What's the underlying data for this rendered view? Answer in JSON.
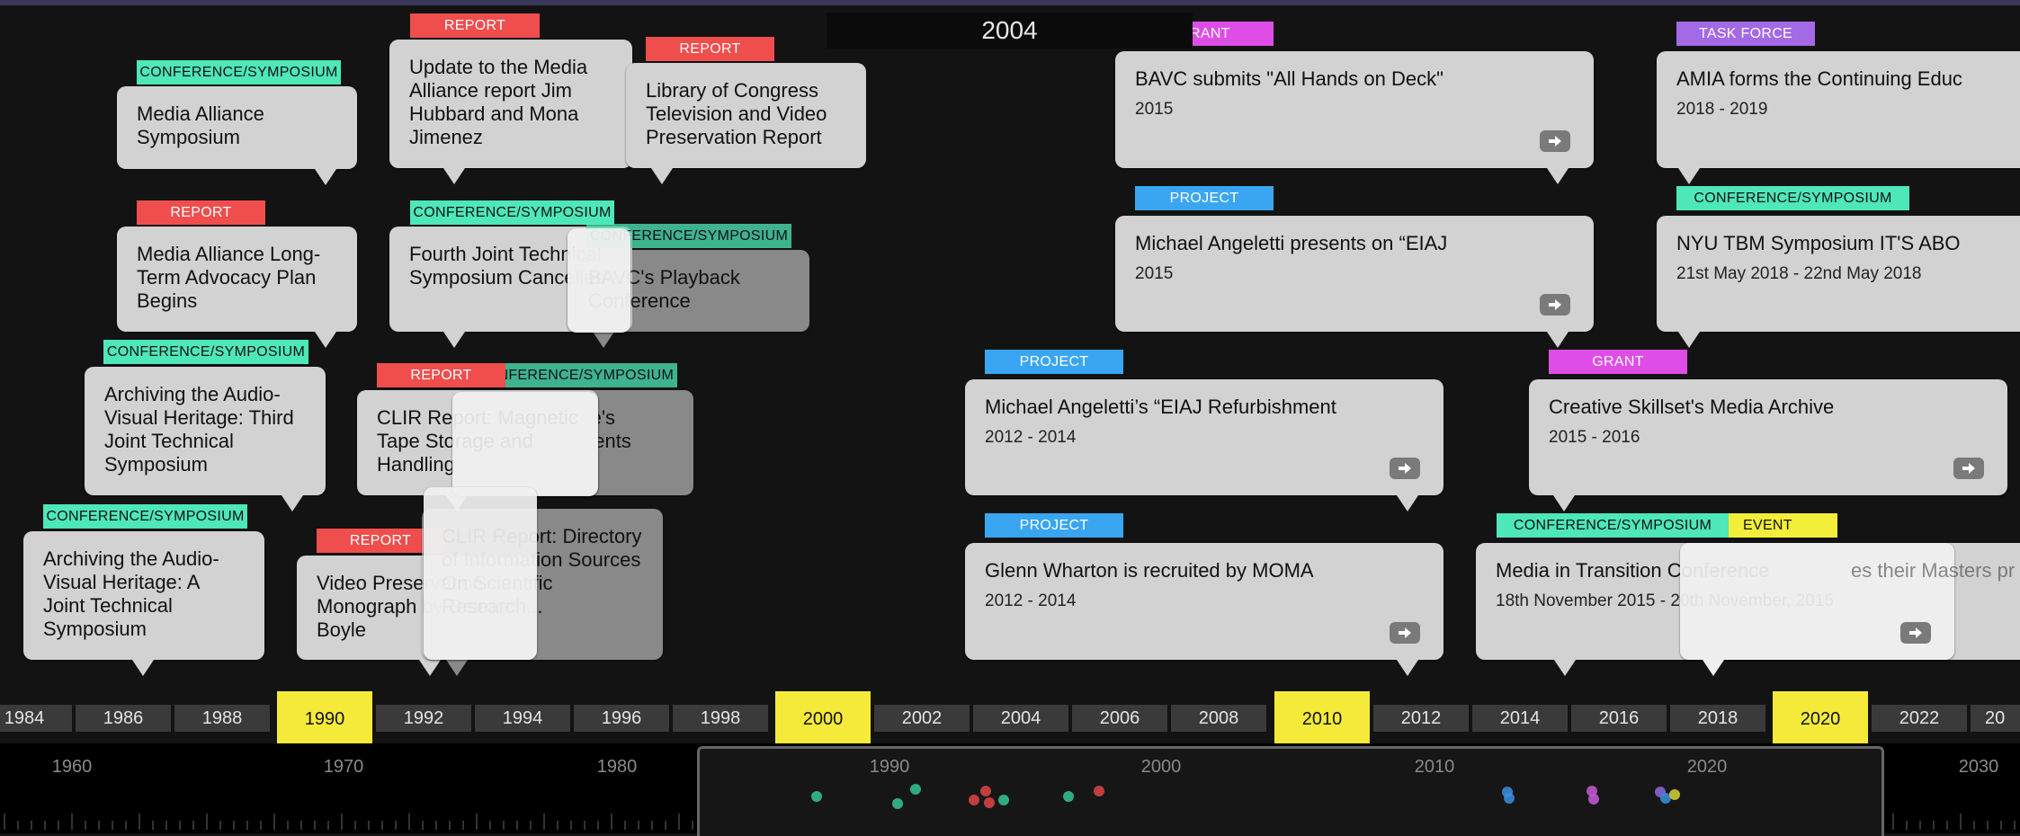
{
  "center_date": "2004",
  "timeline_events": [
    {
      "tag": "CONFERENCE/SYMPOSIUM",
      "tag_color": "#4ee7b8",
      "title": "Media Alliance Symposium",
      "date": ""
    },
    {
      "tag": "REPORT",
      "tag_color": "#f04d4d",
      "title": "Update to the Media Alliance report Jim Hubbard and Mona Jimenez",
      "date": ""
    },
    {
      "tag": "REPORT",
      "tag_color": "#f04d4d",
      "title": "Library of Congress Television and Video Preservation Report",
      "date": ""
    },
    {
      "tag": "REPORT",
      "tag_color": "#f04d4d",
      "title": "Media Alliance Long-Term Advocacy Plan Begins",
      "date": ""
    },
    {
      "tag": "CONFERENCE/SYMPOSIUM",
      "tag_color": "#4ee7b8",
      "title": "Fourth Joint Technical Symposium Cancelled",
      "date": ""
    },
    {
      "tag": "CONFERENCE/SYMPOSIUM",
      "tag_color": "#4ee7b8",
      "title": "BAVC's Playback Conference",
      "date": ""
    },
    {
      "tag": "CONFERENCE/SYMPOSIUM",
      "tag_color": "#4ee7b8",
      "title": "Archiving the Audio-Visual Heritage: Third Joint Technical Symposium",
      "date": ""
    },
    {
      "tag": "CONFERENCE/SYMPOSIUM",
      "tag_color": "#4ee7b8",
      "title": "Media Alliance's Principle Currents",
      "date": ""
    },
    {
      "tag": "REPORT",
      "tag_color": "#f04d4d",
      "title": "CLIR Report: Magnetic Tape Storage and Handling",
      "date": ""
    },
    {
      "tag": "CONFERENCE/SYMPOSIUM",
      "tag_color": "#4ee7b8",
      "title": "Archiving the Audio-Visual Heritage: A Joint Technical Symposium",
      "date": ""
    },
    {
      "tag": "REPORT",
      "tag_color": "#f04d4d",
      "title": "Video Preservation Monograph by Deirdre Boyle",
      "date": ""
    },
    {
      "tag": "REPORT",
      "tag_color": "#f04d4d",
      "title": "CLIR Report: Directory of Information Sources On Scientific Research...",
      "date": ""
    },
    {
      "tag": "GRANT",
      "tag_color": "#de4ee6",
      "title": "BAVC submits \"All Hands on Deck\"",
      "date": "2015"
    },
    {
      "tag": "PROJECT",
      "tag_color": "#3aa6f2",
      "title": "Michael Angeletti presents on “EIAJ",
      "date": "2015"
    },
    {
      "tag": "PROJECT",
      "tag_color": "#3aa6f2",
      "title": "Michael Angeletti’s “EIAJ Refurbishment",
      "date": "2012 - 2014"
    },
    {
      "tag": "PROJECT",
      "tag_color": "#3aa6f2",
      "title": "Glenn Wharton is recruited by MOMA",
      "date": "2012 - 2014"
    },
    {
      "tag": "TASK FORCE",
      "tag_color": "#a369e6",
      "title": "AMIA forms the Continuing Educ",
      "date": "2018 - 2019"
    },
    {
      "tag": "CONFERENCE/SYMPOSIUM",
      "tag_color": "#4ee7b8",
      "title": "NYU TBM Symposium IT'S ABO",
      "date": "21st May 2018 - 22nd May 2018"
    },
    {
      "tag": "GRANT",
      "tag_color": "#de4ee6",
      "title": "Creative Skillset's Media Archive",
      "date": "2015 - 2016"
    },
    {
      "tag": "CONFERENCE/SYMPOSIUM",
      "tag_color": "#4ee7b8",
      "title": "Media in Transition Conference",
      "date": "18th November 2015 - 20th November, 2015"
    },
    {
      "tag": "EVENT",
      "tag_color": "#f2ee3a",
      "title": "",
      "date": ""
    }
  ],
  "ghost_overlap_text": "es their Masters pr",
  "ruler_years": [
    "1984",
    "1986",
    "1988",
    "1990",
    "1992",
    "1994",
    "1996",
    "1998",
    "2000",
    "2002",
    "2004",
    "2006",
    "2008",
    "2010",
    "2012",
    "2014",
    "2016",
    "2018",
    "2020",
    "2022",
    "20"
  ],
  "ruler_highlight_years": [
    "1990",
    "2000",
    "2010",
    "2020"
  ],
  "navigator_years": [
    "1960",
    "1970",
    "1980",
    "1990",
    "2000",
    "2010",
    "2020",
    "2030"
  ],
  "icons": {
    "card_arrow": "arrow-right-icon"
  }
}
